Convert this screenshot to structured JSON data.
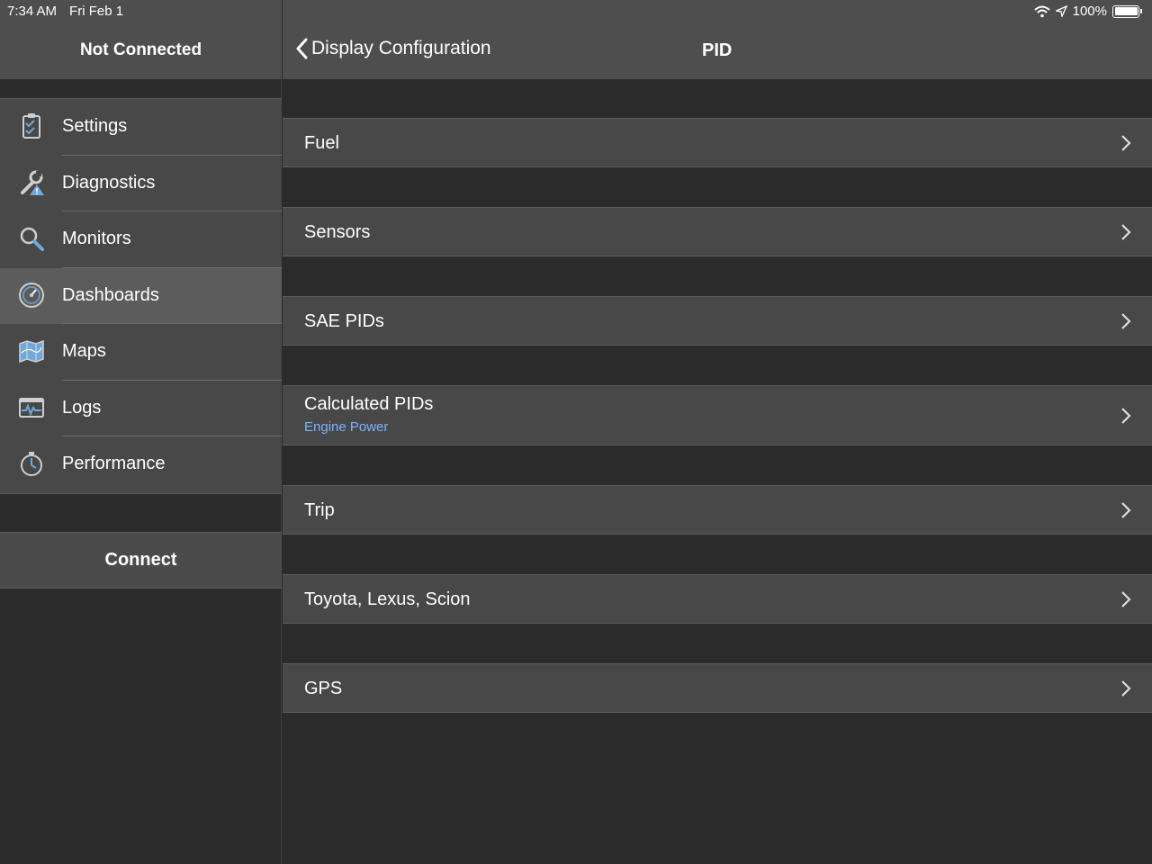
{
  "status_bar": {
    "time": "7:34 AM",
    "date": "Fri Feb 1",
    "battery": "100%"
  },
  "sidebar": {
    "title": "Not Connected",
    "items": [
      {
        "label": "Settings",
        "icon": "clipboard-check-icon"
      },
      {
        "label": "Diagnostics",
        "icon": "wrench-warning-icon"
      },
      {
        "label": "Monitors",
        "icon": "magnifier-icon"
      },
      {
        "label": "Dashboards",
        "icon": "gauge-icon",
        "selected": true
      },
      {
        "label": "Maps",
        "icon": "map-icon"
      },
      {
        "label": "Logs",
        "icon": "waveform-log-icon"
      },
      {
        "label": "Performance",
        "icon": "stopwatch-icon"
      }
    ],
    "connect_label": "Connect"
  },
  "header": {
    "back_label": "Display Configuration",
    "title": "PID"
  },
  "list": [
    {
      "label": "Fuel",
      "sub": ""
    },
    {
      "label": "Sensors",
      "sub": ""
    },
    {
      "label": "SAE PIDs",
      "sub": ""
    },
    {
      "label": "Calculated PIDs",
      "sub": "Engine Power"
    },
    {
      "label": "Trip",
      "sub": ""
    },
    {
      "label": "Toyota, Lexus, Scion",
      "sub": ""
    },
    {
      "label": "GPS",
      "sub": ""
    }
  ],
  "colors": {
    "header_bg": "#4e4e4e",
    "row_bg": "#484848",
    "page_bg": "#2b2b2b",
    "accent_sub": "#7ab3ff",
    "icon_blue": "#6fa8dc"
  }
}
